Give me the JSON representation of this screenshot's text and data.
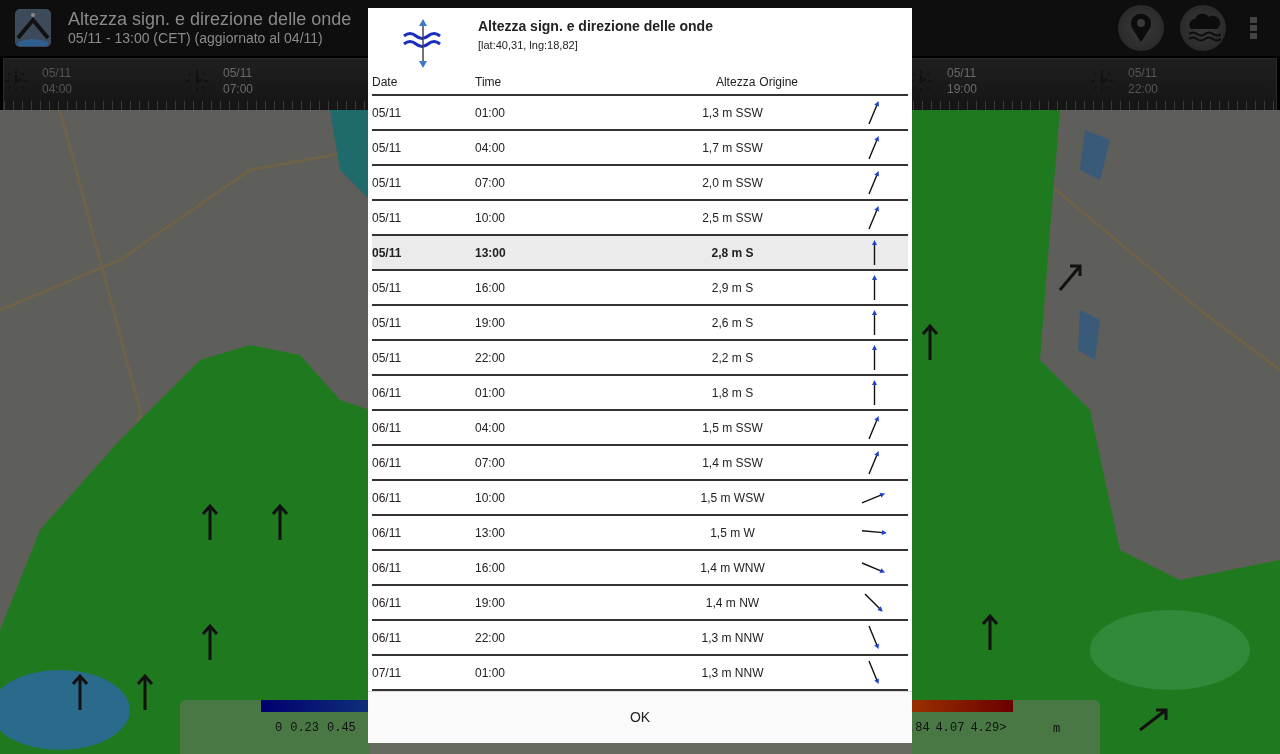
{
  "app_bar": {
    "title": "Altezza sign. e direzione delle onde",
    "subtitle": "05/11 - 13:00 (CET) (aggiornato al 04/11)"
  },
  "timeline": {
    "marks_left": [
      {
        "date": "05/11",
        "time": "04:00",
        "faded": true
      },
      {
        "date": "05/11",
        "time": "07:00",
        "faded": false
      }
    ],
    "marks_right": [
      {
        "date": "05/11",
        "time": "19:00",
        "faded": false
      },
      {
        "date": "05/11",
        "time": "22:00",
        "faded": true
      }
    ]
  },
  "legend": {
    "left_labels": [
      "0",
      "0.23",
      "0.45"
    ],
    "right_labels": [
      ".84",
      "4.07",
      "4.29>"
    ],
    "unit": "m"
  },
  "dialog": {
    "title": "Altezza sign. e direzione delle onde",
    "coords": "[lat:40,31, lng:18,82]",
    "columns": [
      "Date",
      "Time",
      "Altezza",
      "Origine"
    ],
    "rows": [
      {
        "date": "05/11",
        "time": "01:00",
        "value": "1,3 m SSW",
        "kind": "nne",
        "selected": false
      },
      {
        "date": "05/11",
        "time": "04:00",
        "value": "1,7 m SSW",
        "kind": "nne",
        "selected": false
      },
      {
        "date": "05/11",
        "time": "07:00",
        "value": "2,0 m SSW",
        "kind": "nne",
        "selected": false
      },
      {
        "date": "05/11",
        "time": "10:00",
        "value": "2,5 m SSW",
        "kind": "nne",
        "selected": false
      },
      {
        "date": "05/11",
        "time": "13:00",
        "value": "2,8 m S",
        "kind": "n",
        "selected": true
      },
      {
        "date": "05/11",
        "time": "16:00",
        "value": "2,9 m S",
        "kind": "n",
        "selected": false
      },
      {
        "date": "05/11",
        "time": "19:00",
        "value": "2,6 m S",
        "kind": "n",
        "selected": false
      },
      {
        "date": "05/11",
        "time": "22:00",
        "value": "2,2 m S",
        "kind": "n",
        "selected": false
      },
      {
        "date": "06/11",
        "time": "01:00",
        "value": "1,8 m S",
        "kind": "n",
        "selected": false
      },
      {
        "date": "06/11",
        "time": "04:00",
        "value": "1,5 m SSW",
        "kind": "nne",
        "selected": false
      },
      {
        "date": "06/11",
        "time": "07:00",
        "value": "1,4 m SSW",
        "kind": "nne",
        "selected": false
      },
      {
        "date": "06/11",
        "time": "10:00",
        "value": "1,5 m WSW",
        "kind": "ene",
        "selected": false
      },
      {
        "date": "06/11",
        "time": "13:00",
        "value": "1,5 m W",
        "kind": "e",
        "selected": false
      },
      {
        "date": "06/11",
        "time": "16:00",
        "value": "1,4 m WNW",
        "kind": "ese",
        "selected": false
      },
      {
        "date": "06/11",
        "time": "19:00",
        "value": "1,4 m NW",
        "kind": "se",
        "selected": false
      },
      {
        "date": "06/11",
        "time": "22:00",
        "value": "1,3 m NNW",
        "kind": "sse",
        "selected": false
      },
      {
        "date": "07/11",
        "time": "01:00",
        "value": "1,3 m NNW",
        "kind": "sse",
        "selected": false
      }
    ],
    "button": "OK"
  }
}
